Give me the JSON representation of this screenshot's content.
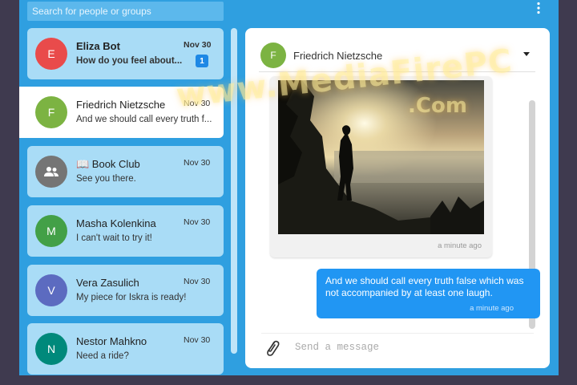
{
  "search": {
    "placeholder": "Search for people or groups"
  },
  "menu": {
    "icon": "more-vert-icon"
  },
  "contacts": [
    {
      "initial": "E",
      "color": "#e94b4b",
      "name": "Eliza Bot",
      "preview": "How do you feel about...",
      "date": "Nov 30",
      "unread": "1"
    },
    {
      "initial": "F",
      "color": "#7cb342",
      "name": "Friedrich Nietzsche",
      "preview": "And we should call every truth f...",
      "date": "Nov 30"
    },
    {
      "icon": "group-icon",
      "color": "#757575",
      "name": "📖 Book Club",
      "preview": "See you there.",
      "date": "Nov 30"
    },
    {
      "initial": "M",
      "color": "#43a047",
      "name": "Masha Kolenkina",
      "preview": "I can't wait to try it!",
      "date": "Nov 30"
    },
    {
      "initial": "V",
      "color": "#5c6bc0",
      "name": "Vera Zasulich",
      "preview": "My piece for Iskra is ready!",
      "date": "Nov 30"
    },
    {
      "initial": "N",
      "color": "#00897b",
      "name": "Nestor Mahkno",
      "preview": "Need a ride?",
      "date": "Nov 30"
    }
  ],
  "chat": {
    "header": {
      "initial": "F",
      "color": "#7cb342",
      "name": "Friedrich Nietzsche"
    },
    "messages": [
      {
        "type": "image",
        "image": "sunset-silhouette-photo",
        "time": "a minute ago"
      },
      {
        "type": "text",
        "text": "And we should call every truth false which was not accompanied by at least one laugh.",
        "time": "a minute ago"
      }
    ],
    "composer": {
      "placeholder": "Send a message",
      "attach_icon": "paperclip-icon"
    }
  },
  "watermark": {
    "line1": "www.MediaFirePC",
    "line2": ".Com"
  }
}
